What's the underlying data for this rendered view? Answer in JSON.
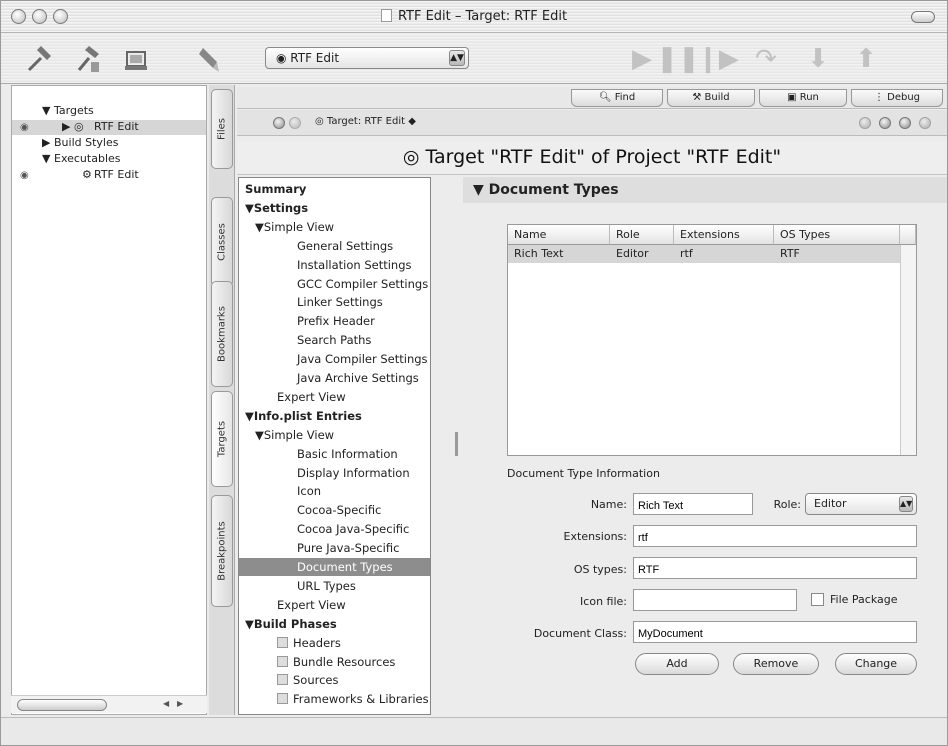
{
  "window": {
    "title": "RTF Edit – Target: RTF Edit"
  },
  "toolbar": {
    "active_target": "RTF Edit",
    "icons": [
      "hammer-icon",
      "build-clean-icon",
      "build-run-icon",
      "inspector-brush-icon"
    ],
    "run_controls": [
      "play-icon",
      "pause-icon",
      "step-icon",
      "step-over-icon",
      "step-into-icon",
      "step-out-icon"
    ]
  },
  "groups": {
    "items": [
      {
        "label": "Targets",
        "disclosure": "▼",
        "indent": 0
      },
      {
        "label": "RTF Edit",
        "disclosure": "▶ ◎",
        "indent": 1,
        "selected": true,
        "radio": true
      },
      {
        "label": "Build Styles",
        "disclosure": "▶",
        "indent": 0
      },
      {
        "label": "Executables",
        "disclosure": "▼",
        "indent": 0
      },
      {
        "label": "RTF Edit",
        "disclosure": "⚙",
        "indent": 2,
        "radio": true
      }
    ]
  },
  "side_tabs": [
    "Files",
    "Classes",
    "Bookmarks",
    "Targets",
    "Breakpoints"
  ],
  "small_toolbar": {
    "find": "Find",
    "build": "Build",
    "run": "Run",
    "debug": "Debug"
  },
  "nav": {
    "crumb": "◎ Target: RTF Edit ◆"
  },
  "header": {
    "title": "◎ Target \"RTF Edit\" of Project \"RTF Edit\""
  },
  "outline": [
    {
      "label": "Summary",
      "indent": 0,
      "bold": true
    },
    {
      "label": "▼Settings",
      "indent": 0,
      "bold": true
    },
    {
      "label": "▼Simple View",
      "indent": 1
    },
    {
      "label": "General Settings",
      "indent": 3
    },
    {
      "label": "Installation Settings",
      "indent": 3
    },
    {
      "label": "GCC Compiler Settings",
      "indent": 3
    },
    {
      "label": "Linker Settings",
      "indent": 3
    },
    {
      "label": "Prefix Header",
      "indent": 3
    },
    {
      "label": "Search Paths",
      "indent": 3
    },
    {
      "label": "Java Compiler Settings",
      "indent": 3
    },
    {
      "label": "Java Archive Settings",
      "indent": 3
    },
    {
      "label": "Expert View",
      "indent": 2
    },
    {
      "label": "▼Info.plist Entries",
      "indent": 0,
      "bold": true
    },
    {
      "label": "▼Simple View",
      "indent": 1
    },
    {
      "label": "Basic Information",
      "indent": 3
    },
    {
      "label": "Display Information",
      "indent": 3
    },
    {
      "label": "Icon",
      "indent": 3
    },
    {
      "label": "Cocoa-Specific",
      "indent": 3
    },
    {
      "label": "Cocoa Java-Specific",
      "indent": 3
    },
    {
      "label": "Pure Java-Specific",
      "indent": 3
    },
    {
      "label": "Document Types",
      "indent": 3,
      "selected": true
    },
    {
      "label": "URL Types",
      "indent": 3
    },
    {
      "label": "Expert View",
      "indent": 2
    },
    {
      "label": "▼Build Phases",
      "indent": 0,
      "bold": true
    },
    {
      "label": "Headers",
      "indent": 2,
      "box": true
    },
    {
      "label": "Bundle Resources",
      "indent": 2,
      "box": true
    },
    {
      "label": "Sources",
      "indent": 2,
      "box": true
    },
    {
      "label": "Frameworks & Libraries",
      "indent": 2,
      "box": true
    }
  ],
  "doc_types": {
    "header": "Document Types",
    "columns": [
      "Name",
      "Role",
      "Extensions",
      "OS Types"
    ],
    "rows": [
      {
        "name": "Rich Text",
        "role": "Editor",
        "extensions": "rtf",
        "os_types": "RTF"
      }
    ],
    "info_label": "Document Type Information",
    "form": {
      "name_label": "Name:",
      "name_value": "Rich Text",
      "role_label": "Role:",
      "role_value": "Editor",
      "extensions_label": "Extensions:",
      "extensions_value": "rtf",
      "os_types_label": "OS types:",
      "os_types_value": "RTF",
      "icon_file_label": "Icon file:",
      "icon_file_value": "",
      "file_package_label": "File Package",
      "doc_class_label": "Document Class:",
      "doc_class_value": "MyDocument"
    },
    "buttons": {
      "add": "Add",
      "remove": "Remove",
      "change": "Change"
    }
  }
}
